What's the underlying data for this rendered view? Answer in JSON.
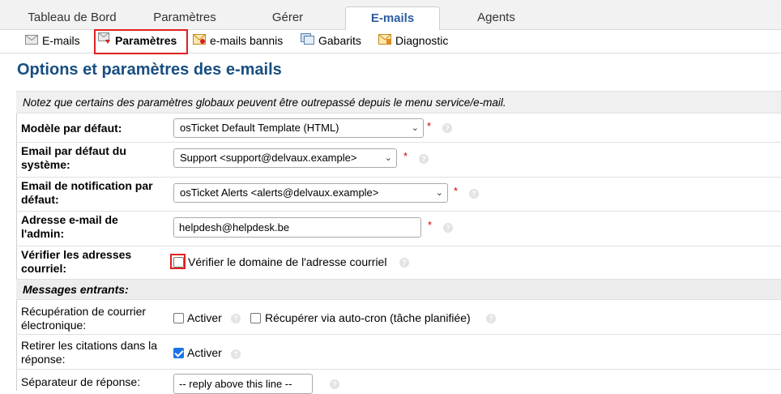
{
  "top_tabs": [
    {
      "label": "Tableau de Bord"
    },
    {
      "label": "Paramètres"
    },
    {
      "label": "Gérer"
    },
    {
      "label": "E-mails"
    },
    {
      "label": "Agents"
    }
  ],
  "sub_nav": [
    {
      "label": "E-mails",
      "icon": "envelope-icon"
    },
    {
      "label": "Paramètres",
      "icon": "settings-mail-icon"
    },
    {
      "label": "e-mails bannis",
      "icon": "banned-mail-icon"
    },
    {
      "label": "Gabarits",
      "icon": "templates-icon"
    },
    {
      "label": "Diagnostic",
      "icon": "diagnostic-icon"
    }
  ],
  "page_title": "Options et paramètres des e-mails",
  "notice": "Notez que certains des paramètres globaux peuvent être outrepassé depuis le menu service/e-mail.",
  "fields": {
    "default_template": {
      "label": "Modèle par défaut:",
      "value": "osTicket Default Template (HTML)"
    },
    "default_system_email": {
      "label_line1": "Email par défaut du",
      "label_line2": "système:",
      "value": "Support <support@delvaux.example>"
    },
    "default_alert_email": {
      "label_line1": "Email de notification par",
      "label_line2": "défaut:",
      "value": "osTicket Alerts <alerts@delvaux.example>"
    },
    "admin_email": {
      "label_line1": "Adresse e-mail de",
      "label_line2": "l'admin:",
      "value": "helpdesh@helpdesk.be"
    },
    "verify_email": {
      "label_line1": "Vérifier les adresses",
      "label_line2": "courriel:",
      "checkbox_label": "Vérifier le domaine de l'adresse courriel"
    }
  },
  "required_mark": "*",
  "help_glyph": "?",
  "incoming_section": "Messages entrants:",
  "incoming": {
    "fetch": {
      "label_line1": "Récupération de courrier",
      "label_line2": "électronique:",
      "enable_label": "Activer",
      "autocron_label": "Récupérer via auto-cron (tâche planifiée)"
    },
    "strip_quotes": {
      "label_line1": "Retirer les citations dans la",
      "label_line2": "réponse:",
      "enable_label": "Activer"
    },
    "separator": {
      "label": "Séparateur de réponse:",
      "value": "-- reply above this line --"
    }
  },
  "colors": {
    "accent": "#184e81",
    "highlight": "#e02020",
    "checkbox": "#1a73e8"
  }
}
